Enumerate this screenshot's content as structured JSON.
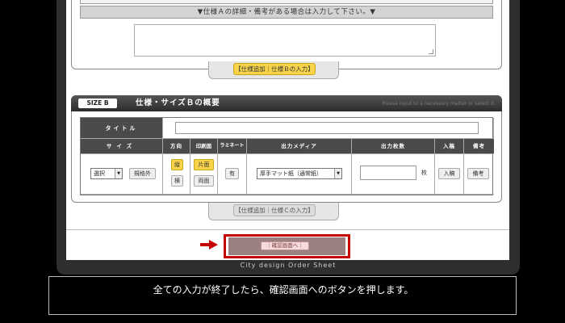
{
  "spec_a": {
    "note": "▼仕様Ａの詳細・備考がある場合は入力して下さい。▼",
    "add_button": "【仕様追加｜仕様Ｂの入力】"
  },
  "spec_b": {
    "badge": "SIZE B",
    "title": "仕様・サイズＢの概要",
    "hint": "Please input to a necessary matter or select it.",
    "headers": {
      "title": "タイトル",
      "size": "サイズ",
      "direction": "方向",
      "print_side": "印刷面",
      "laminate": "ラミネート",
      "media": "出力メディア",
      "count": "出力枚数",
      "draft": "入稿",
      "remarks": "備考"
    },
    "size_select": "選択",
    "nonstandard_button": "規格外",
    "direction_options": [
      "縦",
      "横"
    ],
    "print_options": [
      "片面",
      "両面"
    ],
    "laminate_button": "有",
    "media_select": "厚手マット紙（通常紙）",
    "count_unit": "枚",
    "draft_button": "入稿",
    "remarks_button": "備考",
    "add_button": "【仕様追加｜仕様Ｃの入力】"
  },
  "confirm": {
    "button": "｜確認画面へ｜"
  },
  "footer_label": "City design Order Sheet",
  "caption": "全ての入力が終了したら、確認画面へのボタンを押します。",
  "colors": {
    "highlight": "#c40000",
    "selected_yellow": "#f8d44a",
    "header_dark": "#4a4a4a"
  }
}
